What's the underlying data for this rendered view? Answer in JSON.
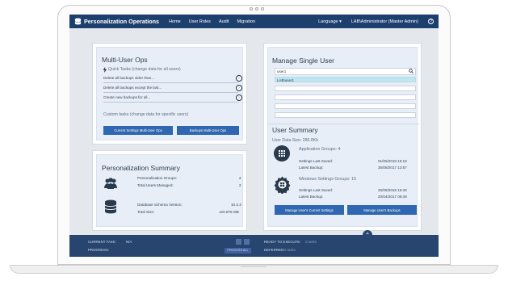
{
  "app": {
    "title": "Personalization Operations"
  },
  "nav": {
    "home": "Home",
    "user_roles": "User Roles",
    "audit": "Audit",
    "migration": "Migration",
    "language": "Language ▾",
    "user": "LAB\\Administrator (Master Admin)",
    "help": "?"
  },
  "multi": {
    "title": "Multi-User Ops",
    "quick_tasks": "Quick Tasks (change data for all users)",
    "tasks": [
      "Delete all backups older than...",
      "Delete all backups except the last...",
      "Create new backups for all..."
    ],
    "custom": "Custom tasks (change data for specific users)",
    "btn_current": "Current Settings Multi-User Ops",
    "btn_backups": "Backups Multi-User Ops"
  },
  "summary": {
    "title": "Personalization Summary",
    "groups_label": "Personalization Groups:",
    "groups_value": "2",
    "users_label": "Total Users Managed:",
    "users_value": "2",
    "schema_label": "Database Schema Version:",
    "schema_value": "10.2.4",
    "size_label": "Total Size:",
    "size_value": "120.875 MB"
  },
  "single": {
    "title": "Manage Single User",
    "search_value": "user1",
    "selected_result": "LAB\\user1",
    "user_summary": "User Summary",
    "data_size": "User Data Size: 286.8Kb",
    "app_groups": "Application Groups: 4",
    "settings_saved_label": "Settings Last Saved:",
    "settings_saved_value": "01/05/2018 16:16",
    "latest_backup_label": "Latest Backup:",
    "latest_backup_value": "30/08/2017 13:57",
    "win_groups": "Windows Settings Groups: 15",
    "win_saved_value": "25/06/2018 16:40",
    "win_backup_value": "20/04/2017 08:49",
    "btn_current": "Manage User's Current Settings",
    "btn_backups": "Manage User's Backups"
  },
  "footer": {
    "current_task": "CURRENT TASK:",
    "task_value": "N/A",
    "progress": "PROGRESS:",
    "ready": "READY TO EXECUTE:",
    "ready_value": "0 tasks",
    "deferred": "DEFERRED:",
    "deferred_value": "0 tasks",
    "process_label": "PROCESS ALL"
  },
  "colors": {
    "nav": "#1c3f6e",
    "button": "#2f67b0",
    "footer": "#27456f"
  }
}
